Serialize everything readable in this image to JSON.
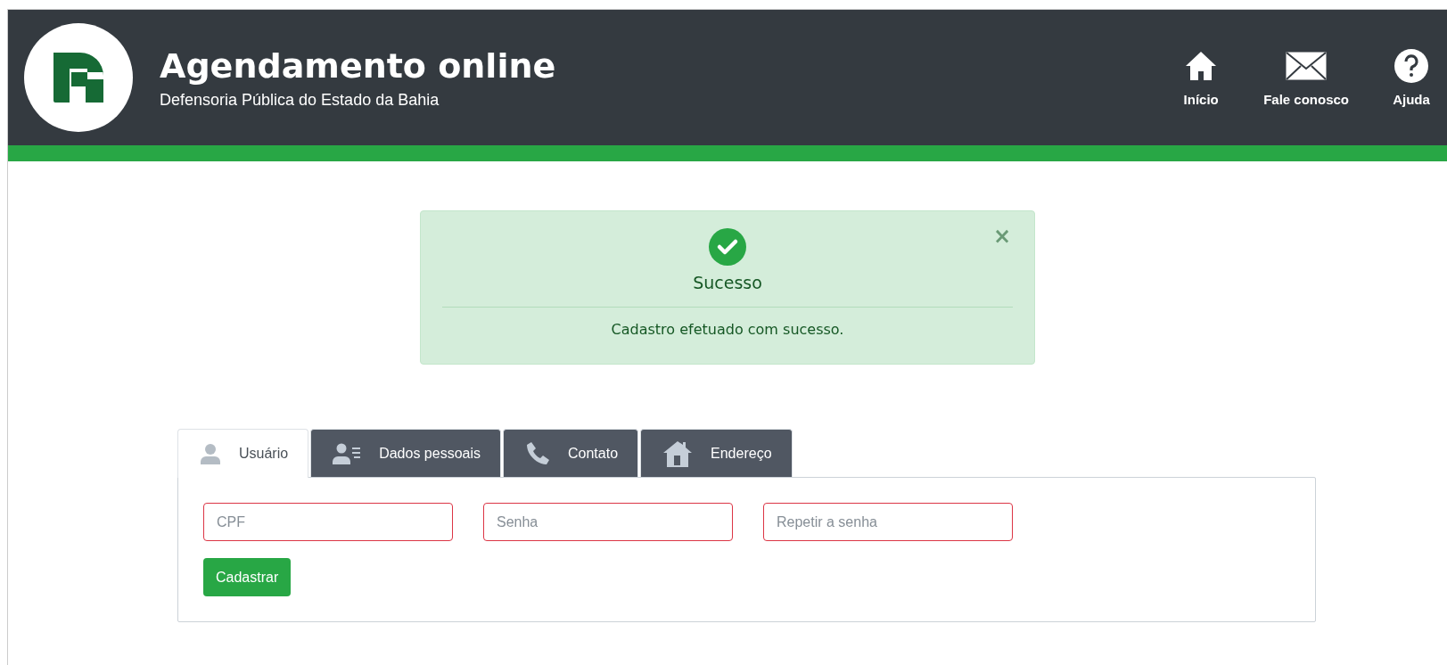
{
  "header": {
    "title": "Agendamento online",
    "subtitle": "Defensoria Pública do Estado da Bahia",
    "nav": [
      {
        "kind": "home",
        "label": "Início"
      },
      {
        "kind": "mail",
        "label": "Fale conosco"
      },
      {
        "kind": "help",
        "label": "Ajuda"
      }
    ]
  },
  "alert": {
    "title": "Sucesso",
    "message": "Cadastro efetuado com sucesso.",
    "close": "×"
  },
  "tabs": [
    {
      "kind": "user",
      "label": "Usuário",
      "selected": true
    },
    {
      "kind": "id",
      "label": "Dados pessoais",
      "selected": false
    },
    {
      "kind": "phone",
      "label": "Contato",
      "selected": false
    },
    {
      "kind": "house",
      "label": "Endereço",
      "selected": false
    }
  ],
  "form": {
    "fields": [
      {
        "placeholder": "CPF",
        "invalid": true
      },
      {
        "placeholder": "Senha",
        "invalid": true
      },
      {
        "placeholder": "Repetir a senha",
        "invalid": true
      }
    ],
    "submit": "Cadastrar"
  }
}
